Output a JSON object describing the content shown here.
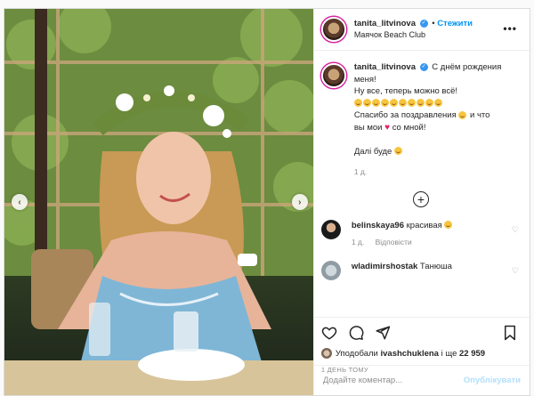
{
  "post": {
    "username": "tanita_litvinova",
    "follow_label": "Стежити",
    "location": "Маячок Beach Club",
    "more_icon": "more-icon",
    "caption": {
      "line1": "С днём рождения",
      "line2": "меня!",
      "line3": "Ну все, теперь можно всё!",
      "line4": "Спасибо за поздравления",
      "line4b": "и что",
      "line5a": "вы мои",
      "line5b": "со мной!",
      "line6": "Далі буде",
      "age": "1 д."
    },
    "comments": [
      {
        "username": "belinskaya96",
        "text": "красивая",
        "age": "1 д.",
        "reply": "Відповісти"
      },
      {
        "username": "wladimirshostak",
        "text": "Танюша",
        "age": "",
        "reply": ""
      }
    ],
    "likes": {
      "prefix": "Уподобали",
      "user": "ivashchuklena",
      "suffix": "і ще",
      "count": "22 959"
    },
    "timestamp": "1 ДЕНЬ ТОМУ",
    "comment_placeholder": "Додайте коментар...",
    "publish_label": "Опублікувати"
  },
  "colors": {
    "accent": "#0095f6",
    "verified": "#3897f0",
    "muted": "#8e8e8e",
    "publish_disabled": "#b2dffc"
  }
}
